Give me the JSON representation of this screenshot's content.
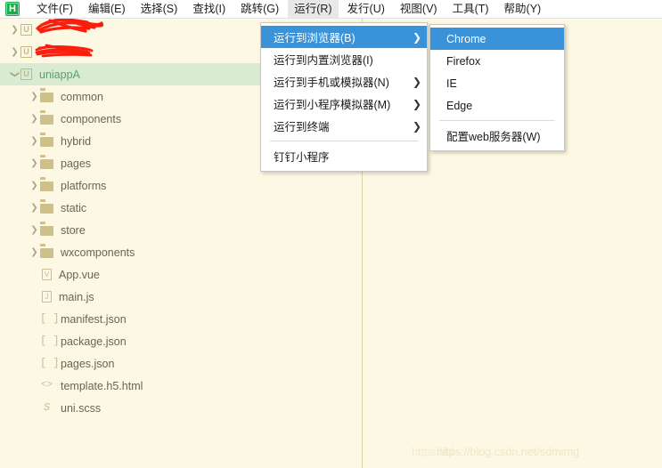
{
  "app": {
    "logo_text": "H",
    "logo_color": "#1aab4b"
  },
  "menubar": {
    "items": [
      {
        "label": "文件(F)",
        "active": false
      },
      {
        "label": "编辑(E)",
        "active": false
      },
      {
        "label": "选择(S)",
        "active": false
      },
      {
        "label": "查找(I)",
        "active": false
      },
      {
        "label": "跳转(G)",
        "active": false
      },
      {
        "label": "运行(R)",
        "active": true
      },
      {
        "label": "发行(U)",
        "active": false
      },
      {
        "label": "视图(V)",
        "active": false
      },
      {
        "label": "工具(T)",
        "active": false
      },
      {
        "label": "帮助(Y)",
        "active": false
      }
    ]
  },
  "dropdown": {
    "highlight_color": "#3a92d8",
    "items": [
      {
        "label": "运行到浏览器(B)",
        "arrow": "❯",
        "highlighted": true,
        "separator_after": false
      },
      {
        "label": "运行到内置浏览器(I)",
        "arrow": "",
        "highlighted": false,
        "separator_after": false
      },
      {
        "label": "运行到手机或模拟器(N)",
        "arrow": "❯",
        "highlighted": false,
        "separator_after": false
      },
      {
        "label": "运行到小程序模拟器(M)",
        "arrow": "❯",
        "highlighted": false,
        "separator_after": false
      },
      {
        "label": "运行到终端",
        "arrow": "❯",
        "highlighted": false,
        "separator_after": true
      },
      {
        "label": "钉钉小程序",
        "arrow": "",
        "highlighted": false,
        "separator_after": false
      }
    ]
  },
  "submenu": {
    "items": [
      {
        "label": "Chrome",
        "highlighted": true,
        "separator_after": false
      },
      {
        "label": "Firefox",
        "highlighted": false,
        "separator_after": false
      },
      {
        "label": "IE",
        "highlighted": false,
        "separator_after": false
      },
      {
        "label": "Edge",
        "highlighted": false,
        "separator_after": true
      },
      {
        "label": "配置web服务器(W)",
        "highlighted": false,
        "separator_after": false
      }
    ]
  },
  "file_tree": {
    "selected_row_color": "#d9ecd2",
    "rows": [
      {
        "label": "",
        "icon": "project-icon",
        "chevron": "collapsed",
        "indent": 0,
        "selected": false,
        "redacted": true
      },
      {
        "label": "",
        "icon": "project-icon",
        "chevron": "collapsed",
        "indent": 0,
        "selected": false,
        "redacted": true
      },
      {
        "label": "uniappA",
        "icon": "project-icon",
        "chevron": "expanded",
        "indent": 0,
        "selected": true,
        "redacted": false
      },
      {
        "label": "common",
        "icon": "folder-icon",
        "chevron": "collapsed",
        "indent": 1,
        "selected": false,
        "redacted": false
      },
      {
        "label": "components",
        "icon": "folder-icon",
        "chevron": "collapsed",
        "indent": 1,
        "selected": false,
        "redacted": false
      },
      {
        "label": "hybrid",
        "icon": "folder-icon",
        "chevron": "collapsed",
        "indent": 1,
        "selected": false,
        "redacted": false
      },
      {
        "label": "pages",
        "icon": "folder-icon",
        "chevron": "collapsed",
        "indent": 1,
        "selected": false,
        "redacted": false
      },
      {
        "label": "platforms",
        "icon": "folder-icon",
        "chevron": "collapsed",
        "indent": 1,
        "selected": false,
        "redacted": false
      },
      {
        "label": "static",
        "icon": "folder-icon",
        "chevron": "collapsed",
        "indent": 1,
        "selected": false,
        "redacted": false
      },
      {
        "label": "store",
        "icon": "folder-icon",
        "chevron": "collapsed",
        "indent": 1,
        "selected": false,
        "redacted": false
      },
      {
        "label": "wxcomponents",
        "icon": "folder-icon",
        "chevron": "collapsed",
        "indent": 1,
        "selected": false,
        "redacted": false
      },
      {
        "label": "App.vue",
        "icon": "vue-file-icon",
        "chevron": "none",
        "indent": 1,
        "selected": false,
        "redacted": false
      },
      {
        "label": "main.js",
        "icon": "js-file-icon",
        "chevron": "none",
        "indent": 1,
        "selected": false,
        "redacted": false
      },
      {
        "label": "manifest.json",
        "icon": "json-file-icon",
        "chevron": "none",
        "indent": 1,
        "selected": false,
        "redacted": false
      },
      {
        "label": "package.json",
        "icon": "json-file-icon",
        "chevron": "none",
        "indent": 1,
        "selected": false,
        "redacted": false
      },
      {
        "label": "pages.json",
        "icon": "json-file-icon",
        "chevron": "none",
        "indent": 1,
        "selected": false,
        "redacted": false
      },
      {
        "label": "template.h5.html",
        "icon": "html-file-icon",
        "chevron": "none",
        "indent": 1,
        "selected": false,
        "redacted": false
      },
      {
        "label": "uni.scss",
        "icon": "scss-file-icon",
        "chevron": "none",
        "indent": 1,
        "selected": false,
        "redacted": false
      }
    ]
  },
  "watermark": {
    "text_a": "https://bl",
    "text_b": "https://blog.csdn.net/sdmimg"
  }
}
